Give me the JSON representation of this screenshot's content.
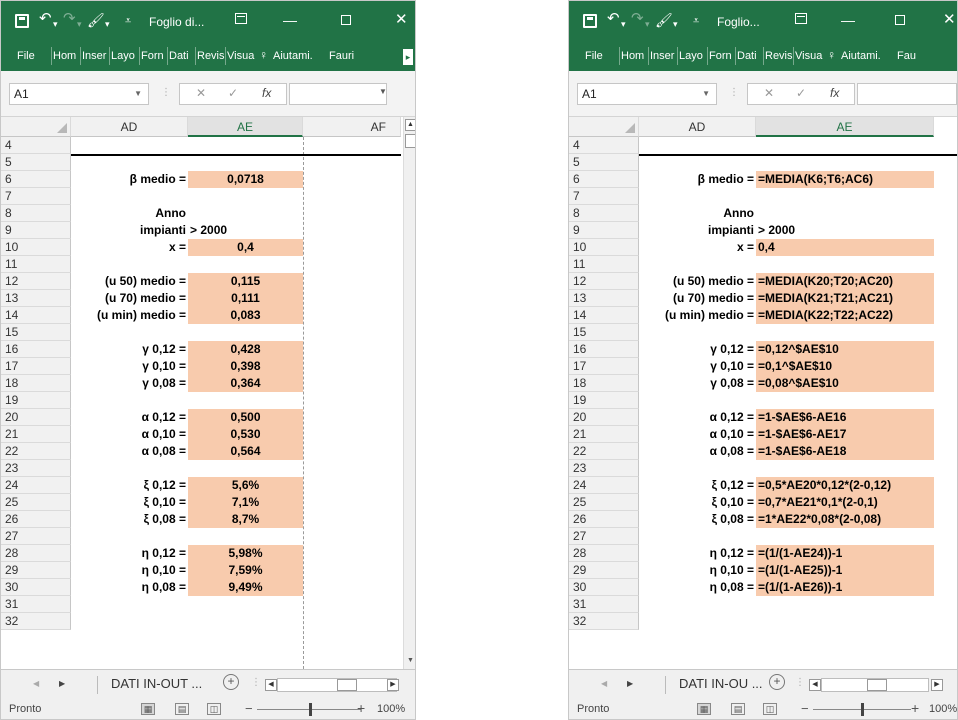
{
  "windows": [
    {
      "id": "formatted",
      "title": "Foglio di...",
      "ribbon_tabs": [
        "File",
        "Hom",
        "Inser",
        "Layo",
        "Forn",
        "Dati",
        "Revis",
        "Visua"
      ],
      "help_label": "Aiutami.",
      "user_label": "Fauri",
      "name_box": "A1",
      "formula_bar": "",
      "columns": [
        "AD",
        "AE",
        "AF"
      ],
      "rows": [
        {
          "n": "4",
          "label": "",
          "value": "",
          "fill": false
        },
        {
          "n": "5",
          "label": "",
          "value": "",
          "fill": false
        },
        {
          "n": "6",
          "label": "β medio =",
          "value": "0,0718",
          "fill": true
        },
        {
          "n": "7",
          "label": "",
          "value": "",
          "fill": false
        },
        {
          "n": "8",
          "label": "Anno",
          "value": "",
          "fill": false
        },
        {
          "n": "9",
          "label": "impianti",
          "value": "> 2000",
          "fill": false,
          "left": true
        },
        {
          "n": "10",
          "label": "x =",
          "value": "0,4",
          "fill": true
        },
        {
          "n": "11",
          "label": "",
          "value": "",
          "fill": false
        },
        {
          "n": "12",
          "label": "(u 50) medio =",
          "value": "0,115",
          "fill": true
        },
        {
          "n": "13",
          "label": "(u 70) medio =",
          "value": "0,111",
          "fill": true
        },
        {
          "n": "14",
          "label": "(u min) medio =",
          "value": "0,083",
          "fill": true
        },
        {
          "n": "15",
          "label": "",
          "value": "",
          "fill": false
        },
        {
          "n": "16",
          "label": "γ 0,12 =",
          "value": "0,428",
          "fill": true
        },
        {
          "n": "17",
          "label": "γ 0,10 =",
          "value": "0,398",
          "fill": true
        },
        {
          "n": "18",
          "label": "γ 0,08 =",
          "value": "0,364",
          "fill": true
        },
        {
          "n": "19",
          "label": "",
          "value": "",
          "fill": false
        },
        {
          "n": "20",
          "label": "α 0,12 =",
          "value": "0,500",
          "fill": true
        },
        {
          "n": "21",
          "label": "α 0,10 =",
          "value": "0,530",
          "fill": true
        },
        {
          "n": "22",
          "label": "α 0,08 =",
          "value": "0,564",
          "fill": true
        },
        {
          "n": "23",
          "label": "",
          "value": "",
          "fill": false
        },
        {
          "n": "24",
          "label": "ξ 0,12 =",
          "value": "5,6%",
          "fill": true
        },
        {
          "n": "25",
          "label": "ξ 0,10 =",
          "value": "7,1%",
          "fill": true
        },
        {
          "n": "26",
          "label": "ξ 0,08 =",
          "value": "8,7%",
          "fill": true
        },
        {
          "n": "27",
          "label": "",
          "value": "",
          "fill": false
        },
        {
          "n": "28",
          "label": "η 0,12 =",
          "value": "5,98%",
          "fill": true
        },
        {
          "n": "29",
          "label": "η 0,10 =",
          "value": "7,59%",
          "fill": true
        },
        {
          "n": "30",
          "label": "η 0,08 =",
          "value": "9,49%",
          "fill": true
        },
        {
          "n": "31",
          "label": "",
          "value": "",
          "fill": false
        },
        {
          "n": "32",
          "label": "",
          "value": "",
          "fill": false
        }
      ],
      "sheet_tab": "DATI IN-OUT ...",
      "status": "Pronto",
      "zoom": "100%"
    },
    {
      "id": "formulas",
      "title": "Foglio...",
      "ribbon_tabs": [
        "File",
        "Hom",
        "Inser",
        "Layo",
        "Forn",
        "Dati",
        "Revis",
        "Visua"
      ],
      "help_label": "Aiutami.",
      "user_label": "Fau",
      "name_box": "A1",
      "formula_bar": "",
      "columns": [
        "AD",
        "AE"
      ],
      "rows": [
        {
          "n": "4",
          "label": "",
          "value": "",
          "fill": false
        },
        {
          "n": "5",
          "label": "",
          "value": "",
          "fill": false
        },
        {
          "n": "6",
          "label": "β medio =",
          "value": "=MEDIA(K6;T6;AC6)",
          "fill": true
        },
        {
          "n": "7",
          "label": "",
          "value": "",
          "fill": false
        },
        {
          "n": "8",
          "label": "Anno",
          "value": "",
          "fill": false
        },
        {
          "n": "9",
          "label": "impianti",
          "value": "> 2000",
          "fill": false
        },
        {
          "n": "10",
          "label": "x =",
          "value": "0,4",
          "fill": true
        },
        {
          "n": "11",
          "label": "",
          "value": "",
          "fill": false
        },
        {
          "n": "12",
          "label": "(u 50) medio =",
          "value": "=MEDIA(K20;T20;AC20)",
          "fill": true
        },
        {
          "n": "13",
          "label": "(u 70) medio =",
          "value": "=MEDIA(K21;T21;AC21)",
          "fill": true
        },
        {
          "n": "14",
          "label": "(u min) medio =",
          "value": "=MEDIA(K22;T22;AC22)",
          "fill": true
        },
        {
          "n": "15",
          "label": "",
          "value": "",
          "fill": false
        },
        {
          "n": "16",
          "label": "γ 0,12 =",
          "value": "=0,12^$AE$10",
          "fill": true
        },
        {
          "n": "17",
          "label": "γ 0,10 =",
          "value": "=0,1^$AE$10",
          "fill": true
        },
        {
          "n": "18",
          "label": "γ 0,08 =",
          "value": "=0,08^$AE$10",
          "fill": true
        },
        {
          "n": "19",
          "label": "",
          "value": "",
          "fill": false
        },
        {
          "n": "20",
          "label": "α 0,12 =",
          "value": "=1-$AE$6-AE16",
          "fill": true
        },
        {
          "n": "21",
          "label": "α 0,10 =",
          "value": "=1-$AE$6-AE17",
          "fill": true
        },
        {
          "n": "22",
          "label": "α 0,08 =",
          "value": "=1-$AE$6-AE18",
          "fill": true
        },
        {
          "n": "23",
          "label": "",
          "value": "",
          "fill": false
        },
        {
          "n": "24",
          "label": "ξ 0,12 =",
          "value": "=0,5*AE20*0,12*(2-0,12)",
          "fill": true
        },
        {
          "n": "25",
          "label": "ξ 0,10 =",
          "value": "=0,7*AE21*0,1*(2-0,1)",
          "fill": true
        },
        {
          "n": "26",
          "label": "ξ 0,08 =",
          "value": "=1*AE22*0,08*(2-0,08)",
          "fill": true
        },
        {
          "n": "27",
          "label": "",
          "value": "",
          "fill": false
        },
        {
          "n": "28",
          "label": "η 0,12 =",
          "value": "=(1/(1-AE24))-1",
          "fill": true
        },
        {
          "n": "29",
          "label": "η 0,10 =",
          "value": "=(1/(1-AE25))-1",
          "fill": true
        },
        {
          "n": "30",
          "label": "η 0,08 =",
          "value": "=(1/(1-AE26))-1",
          "fill": true
        },
        {
          "n": "31",
          "label": "",
          "value": "",
          "fill": false
        },
        {
          "n": "32",
          "label": "",
          "value": "",
          "fill": false
        }
      ],
      "sheet_tab": "DATI IN-OU ...",
      "status": "Pronto",
      "zoom": "100%"
    }
  ],
  "icons": {
    "save": "save-icon",
    "undo": "undo-icon",
    "redo": "redo-icon",
    "help": "lightbulb-icon",
    "function": "fx-icon",
    "add_sheet": "plus-circle-icon"
  }
}
